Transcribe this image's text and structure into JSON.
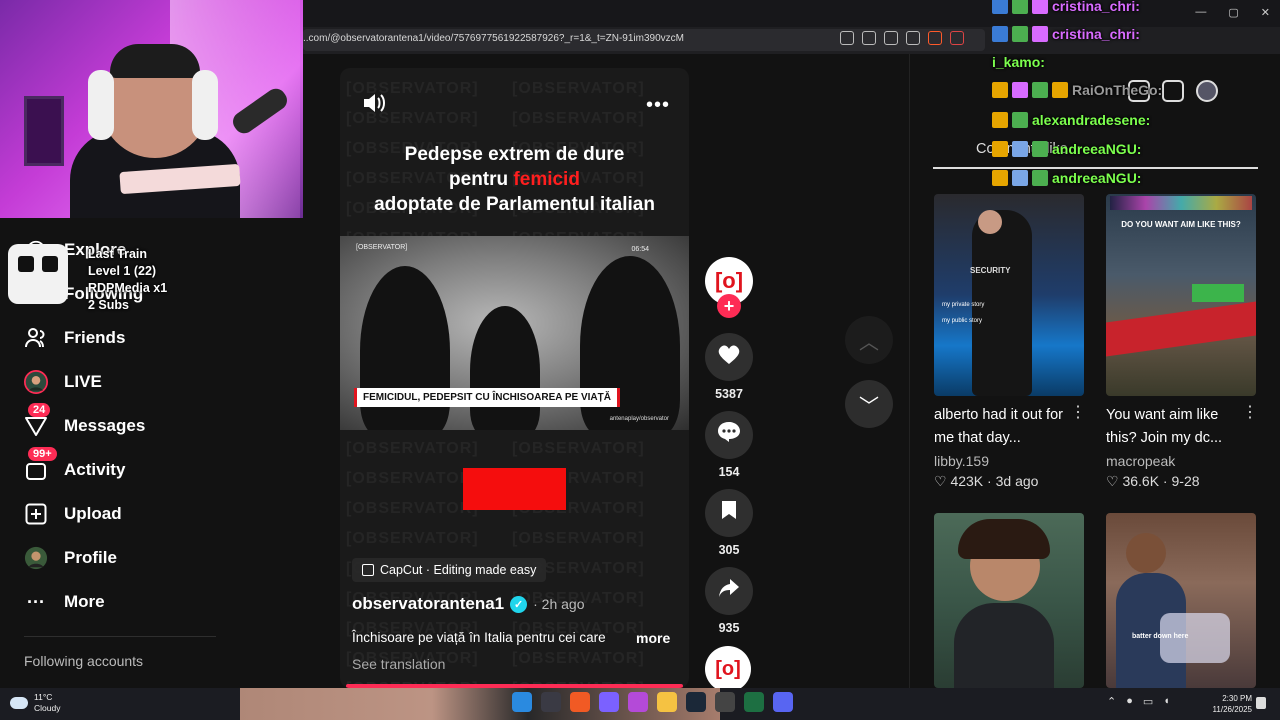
{
  "browser": {
    "url": "..com/@observatorantena1/video/7576977561922587926?_r=1&_t=ZN-91im390vzcM"
  },
  "overlay": {
    "train_lines": [
      "Last Train",
      "Level 1  (22)",
      "RDPMedia x1",
      "2 Subs"
    ]
  },
  "sidebar": {
    "items": [
      {
        "label": "Explore",
        "icon": "compass-icon"
      },
      {
        "label": "Following",
        "icon": "users-icon"
      },
      {
        "label": "Friends",
        "icon": "friends-icon"
      },
      {
        "label": "LIVE",
        "icon": "live-avatar-icon"
      },
      {
        "label": "Messages",
        "icon": "send-icon",
        "badge": "24"
      },
      {
        "label": "Activity",
        "icon": "activity-icon",
        "badge": "99+"
      },
      {
        "label": "Upload",
        "icon": "upload-icon"
      },
      {
        "label": "Profile",
        "icon": "avatar-icon"
      },
      {
        "label": "More",
        "icon": "more-icon"
      }
    ],
    "following_accounts": "Following accounts"
  },
  "video": {
    "watermark": "[OBSERVATOR]",
    "title_line1": "Pedepse extrem de dure",
    "title_line2_a": "pentru ",
    "title_line2_red": "femicid",
    "title_line3": "adoptate de Parlamentul italian",
    "clip_tag": "[OBSERVATOR]",
    "clip_time": "06:54",
    "clip_caption": "FEMICIDUL, PEDEPSIT CU ÎNCHISOAREA PE VIAȚĂ",
    "clip_credit": "antenaplay/observator",
    "capcut": "CapCut · Editing made easy",
    "author": "observatorantena1",
    "verified_mark": "✓",
    "posted": "· 2h ago",
    "description": "Închisoare pe viață în Italia pentru cei care",
    "more": "more",
    "see_translation": "See translation"
  },
  "actions": {
    "avatar_text": "[o]",
    "likes": "5387",
    "comments": "154",
    "saves": "305",
    "shares": "935"
  },
  "chat": [
    {
      "user": "cristina_chri:",
      "color": "#d86bff"
    },
    {
      "user": "cristina_chri:",
      "color": "#d86bff"
    },
    {
      "user": "i_kamo:",
      "color": "#7cff4e"
    },
    {
      "user": "RaiOnTheGo:",
      "color": "#9a9a9a"
    },
    {
      "user": "alexandradesene:",
      "color": "#7cff4e"
    },
    {
      "user": "andreeaNGU:",
      "color": "#7cff4e"
    },
    {
      "user": "andreeaNGU:",
      "color": "#7cff4e"
    }
  ],
  "comments_tab": {
    "text": "Comm  nts  like"
  },
  "recommended": [
    {
      "title": "alberto had it out for me that day...",
      "author": "libby.159",
      "likes": "423K",
      "age": "3d ago",
      "overlay": ""
    },
    {
      "title": "You want aim like this? Join my dc...",
      "author": "macropeak",
      "likes": "36.6K",
      "age": "9-28",
      "overlay": "DO YOU WANT AIM LIKE THIS?"
    },
    {
      "title": "",
      "author": "",
      "likes": "",
      "age": "",
      "overlay": ""
    },
    {
      "title": "",
      "author": "",
      "likes": "",
      "age": "",
      "overlay": "batter down here"
    }
  ],
  "thumb1_text": {
    "security": "SECURITY",
    "private": "my private story",
    "public": "my public story"
  },
  "taskbar": {
    "temp": "11°C",
    "weather": "Cloudy",
    "time": "2:30 PM",
    "date": "11/26/2025"
  }
}
